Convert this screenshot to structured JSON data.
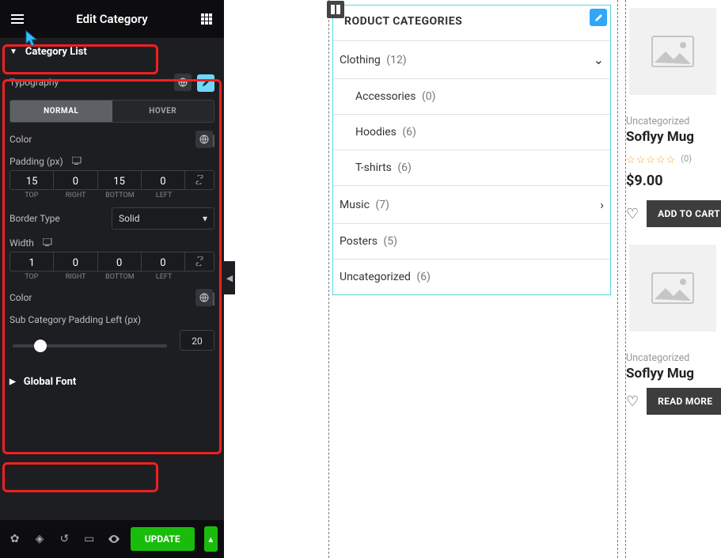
{
  "panel_title": "Edit Category",
  "sections": {
    "category_list_label": "Category List",
    "global_font_label": "Global Font"
  },
  "typography": {
    "heading": "Typography",
    "tab_normal": "NORMAL",
    "tab_hover": "HOVER",
    "color_label": "Color",
    "padding_label": "Padding (px)",
    "padding": {
      "top": "15",
      "right": "0",
      "bottom": "15",
      "left": "0"
    },
    "pad_lbl": {
      "top": "TOP",
      "right": "RIGHT",
      "bottom": "BOTTOM",
      "left": "LEFT"
    },
    "border_type_label": "Border Type",
    "border_type_value": "Solid",
    "width_label": "Width",
    "width": {
      "top": "1",
      "right": "0",
      "bottom": "0",
      "left": "0"
    },
    "color2_label": "Color",
    "subcat_label": "Sub Category Padding Left (px)",
    "subcat_value": "20"
  },
  "footer": {
    "update_label": "UPDATE"
  },
  "widget": {
    "title": "RODUCT CATEGORIES",
    "items": [
      {
        "label": "Clothing",
        "count": "(12)",
        "chevron": "v",
        "child": false
      },
      {
        "label": "Accessories",
        "count": "(0)",
        "child": true
      },
      {
        "label": "Hoodies",
        "count": "(6)",
        "child": true
      },
      {
        "label": "T-shirts",
        "count": "(6)",
        "child": true
      },
      {
        "label": "Music",
        "count": "(7)",
        "chevron": ">",
        "child": false
      },
      {
        "label": "Posters",
        "count": "(5)",
        "child": false
      },
      {
        "label": "Uncategorized",
        "count": "(6)",
        "child": false
      }
    ]
  },
  "products": [
    {
      "cat": "Uncategorized",
      "title": "Soflyy Mug",
      "reviews": "(0)",
      "price": "$9.00",
      "btn": "ADD TO CART"
    },
    {
      "cat": "Uncategorized",
      "title": "Soflyy Mug",
      "btn": "READ MORE"
    }
  ]
}
